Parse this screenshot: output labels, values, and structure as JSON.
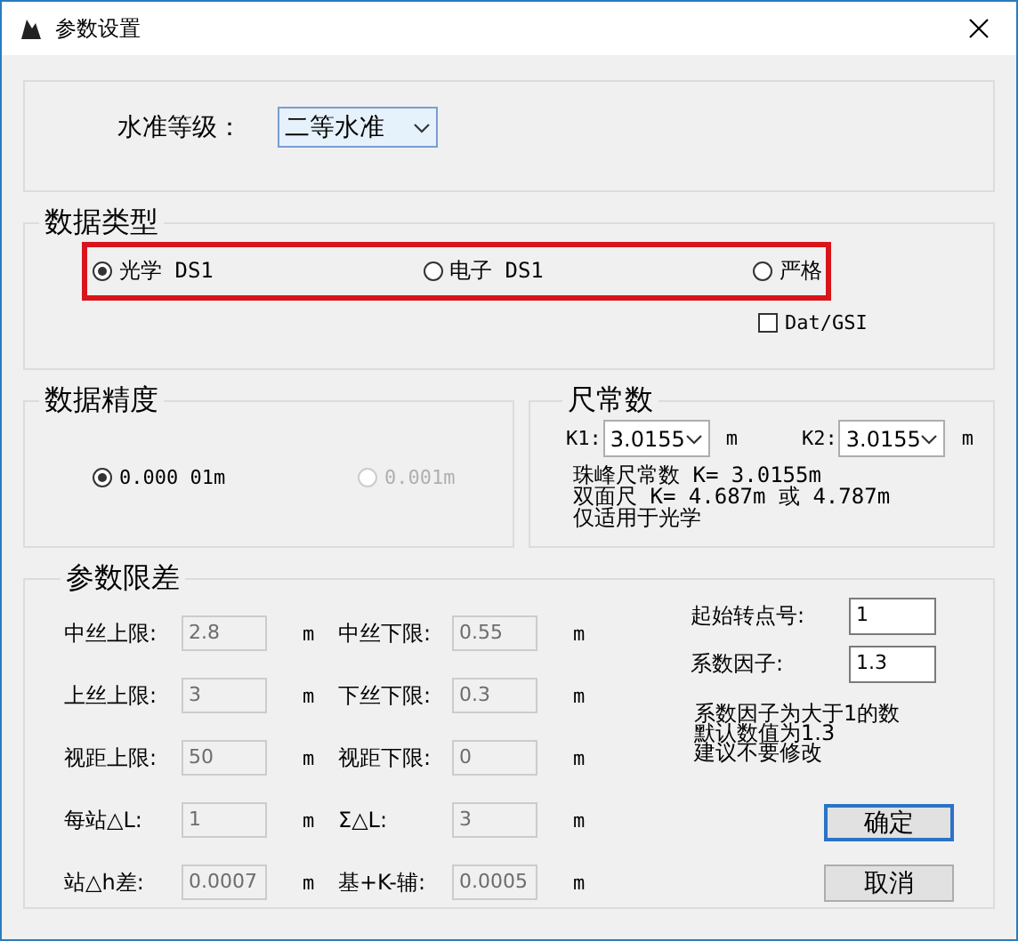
{
  "window": {
    "title": "参数设置"
  },
  "level": {
    "label": "水准等级：",
    "value": "二等水准"
  },
  "data_type": {
    "title": "数据类型",
    "highlighted": true,
    "options": [
      {
        "label": "光学 DS1",
        "selected": true
      },
      {
        "label": "电子 DS1",
        "selected": false
      },
      {
        "label": "严格",
        "selected": false
      }
    ],
    "dat_gsi": {
      "label": "Dat/GSI",
      "checked": false
    }
  },
  "precision": {
    "title": "数据精度",
    "options": [
      {
        "label": "0.000 01m",
        "selected": true,
        "disabled": false
      },
      {
        "label": "0.001m",
        "selected": false,
        "disabled": true
      }
    ]
  },
  "staff_constant": {
    "title": "尺常数",
    "k1": {
      "label": "K1:",
      "value": "3.0155",
      "unit": "m"
    },
    "k2": {
      "label": "K2:",
      "value": "3.0155",
      "unit": "m"
    },
    "notes": [
      "珠峰尺常数 K= 3.0155m",
      "双面尺 K= 4.687m 或 4.787m",
      "仅适用于光学"
    ]
  },
  "limits": {
    "title": "参数限差",
    "fields": [
      {
        "label": "中丝上限:",
        "value": "2.8",
        "unit": "m",
        "disabled": true
      },
      {
        "label": "中丝下限:",
        "value": "0.55",
        "unit": "m",
        "disabled": true
      },
      {
        "label": "上丝上限:",
        "value": "3",
        "unit": "m",
        "disabled": true
      },
      {
        "label": "下丝下限:",
        "value": "0.3",
        "unit": "m",
        "disabled": true
      },
      {
        "label": "视距上限:",
        "value": "50",
        "unit": "m",
        "disabled": true
      },
      {
        "label": "视距下限:",
        "value": "0",
        "unit": "m",
        "disabled": true
      },
      {
        "label": "每站△L:",
        "value": "1",
        "unit": "m",
        "disabled": true
      },
      {
        "label": "Σ△L:",
        "value": "3",
        "unit": "m",
        "disabled": true
      },
      {
        "label": "站△h差:",
        "value": "0.0007",
        "unit": "m",
        "disabled": true
      },
      {
        "label": "基+K-辅:",
        "value": "0.0005",
        "unit": "m",
        "disabled": true
      }
    ],
    "start_point": {
      "label": "起始转点号:",
      "value": "1"
    },
    "factor": {
      "label": "系数因子:",
      "value": "1.3"
    },
    "factor_notes": [
      "系数因子为大于1的数",
      "默认数值为1.3",
      "建议不要修改"
    ],
    "buttons": [
      {
        "label": "确定",
        "focused": true
      },
      {
        "label": "取消",
        "focused": false
      }
    ]
  }
}
